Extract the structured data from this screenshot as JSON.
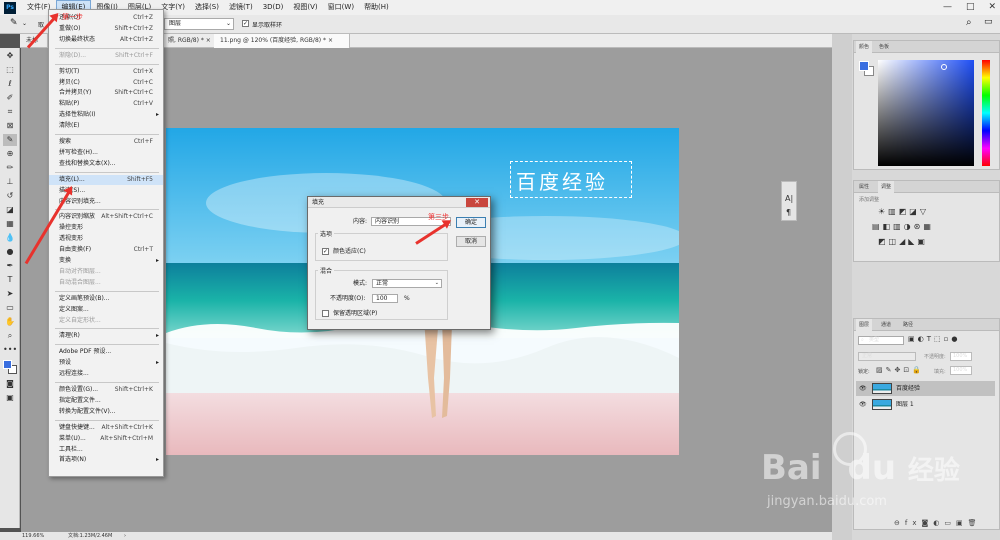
{
  "app": {
    "logo": "Ps"
  },
  "menubar": {
    "items": [
      "文件(F)",
      "编辑(E)",
      "图像(I)",
      "图层(L)",
      "文字(Y)",
      "选择(S)",
      "滤镜(T)",
      "3D(D)",
      "视图(V)",
      "窗口(W)",
      "帮助(H)"
    ],
    "active_index": 1,
    "window_controls": [
      "—",
      "□",
      "✕"
    ]
  },
  "options": {
    "tool_partial": "取",
    "sample_select": "图层",
    "show_ring_label": "显示取样环"
  },
  "tabs": [
    {
      "label": "未标",
      "active": false
    },
    {
      "label": "照, RGB/8) *",
      "active": false
    },
    {
      "label": "11.png @ 120% (百度经验, RGB/8) *",
      "active": true
    }
  ],
  "tab_close": "×",
  "doc": {
    "title_text": "百度经验"
  },
  "statusbar": {
    "zoom": "119.66%",
    "doc": "文档:1.23M/2.46M",
    "arrow": "›"
  },
  "edit_menu": [
    {
      "label": "还原(O)",
      "sc": "Ctrl+Z"
    },
    {
      "label": "重做(O)",
      "sc": "Shift+Ctrl+Z"
    },
    {
      "label": "切换最终状态",
      "sc": "Alt+Ctrl+Z"
    },
    {
      "sep": true
    },
    {
      "label": "渐隐(D)...",
      "sc": "Shift+Ctrl+F",
      "dis": true
    },
    {
      "sep": true
    },
    {
      "label": "剪切(T)",
      "sc": "Ctrl+X"
    },
    {
      "label": "拷贝(C)",
      "sc": "Ctrl+C"
    },
    {
      "label": "合并拷贝(Y)",
      "sc": "Shift+Ctrl+C"
    },
    {
      "label": "粘贴(P)",
      "sc": "Ctrl+V"
    },
    {
      "label": "选择性粘贴(I)",
      "sub": true
    },
    {
      "label": "清除(E)"
    },
    {
      "sep": true
    },
    {
      "label": "搜索",
      "sc": "Ctrl+F"
    },
    {
      "label": "拼写检查(H)..."
    },
    {
      "label": "查找和替换文本(X)..."
    },
    {
      "sep": true
    },
    {
      "label": "填充(L)...",
      "sc": "Shift+F5",
      "hl": true
    },
    {
      "label": "描边(S)..."
    },
    {
      "label": "内容识别填充..."
    },
    {
      "sep": true
    },
    {
      "label": "内容识别缩放",
      "sc": "Alt+Shift+Ctrl+C"
    },
    {
      "label": "操控变形"
    },
    {
      "label": "透视变形"
    },
    {
      "label": "自由变换(F)",
      "sc": "Ctrl+T"
    },
    {
      "label": "变换",
      "sub": true
    },
    {
      "label": "自动对齐图层...",
      "dis": true
    },
    {
      "label": "自动混合图层...",
      "dis": true
    },
    {
      "sep": true
    },
    {
      "label": "定义画笔预设(B)..."
    },
    {
      "label": "定义图案..."
    },
    {
      "label": "定义自定形状...",
      "dis": true
    },
    {
      "sep": true
    },
    {
      "label": "清理(R)",
      "sub": true
    },
    {
      "sep": true
    },
    {
      "label": "Adobe PDF 预设..."
    },
    {
      "label": "预设",
      "sub": true
    },
    {
      "label": "远程连接..."
    },
    {
      "sep": true
    },
    {
      "label": "颜色设置(G)...",
      "sc": "Shift+Ctrl+K"
    },
    {
      "label": "指定配置文件..."
    },
    {
      "label": "转换为配置文件(V)..."
    },
    {
      "sep": true
    },
    {
      "label": "键盘快捷键...",
      "sc": "Alt+Shift+Ctrl+K"
    },
    {
      "label": "菜单(U)...",
      "sc": "Alt+Shift+Ctrl+M"
    },
    {
      "label": "工具栏..."
    },
    {
      "label": "首选项(N)",
      "sub": true
    }
  ],
  "dialog": {
    "title": "填充",
    "close": "✕",
    "content_label": "内容:",
    "content_value": "内容识别",
    "options_title": "选项",
    "color_adapt_label": "颜色适应(C)",
    "color_adapt_checked": true,
    "blend_title": "混合",
    "mode_label": "模式:",
    "mode_value": "正常",
    "opacity_label": "不透明度(O):",
    "opacity_value": "100",
    "opacity_unit": "%",
    "preserve_label": "保留透明区域(P)",
    "preserve_checked": false,
    "ok": "确定",
    "cancel": "取消",
    "caret": "⌄"
  },
  "annotations": {
    "step1": "第一步",
    "step3": "第三步"
  },
  "color_panel": {
    "tabs": [
      "颜色",
      "色板"
    ],
    "foreground": "#3a6fe0",
    "background": "#ffffff"
  },
  "adjust_panel": {
    "tabs": [
      "属性",
      "调整"
    ],
    "hint": "添加调整"
  },
  "layers_panel": {
    "tabs": [
      "图层",
      "通道",
      "路径"
    ],
    "kind_label": "类型",
    "blend_mode": "正常",
    "opacity_label": "不透明度:",
    "opacity": "100%",
    "lock_label": "锁定:",
    "fill_label": "填充:",
    "fill": "100%",
    "layers": [
      {
        "name": "百度经验",
        "selected": true
      },
      {
        "name": "图层 1",
        "selected": false
      }
    ]
  },
  "mini_panel": {
    "icons": [
      "A|",
      "¶"
    ]
  },
  "watermark": {
    "brand": "Bai",
    "brand2": "du",
    "cn": "经验",
    "url": "jingyan.baidu.com"
  }
}
